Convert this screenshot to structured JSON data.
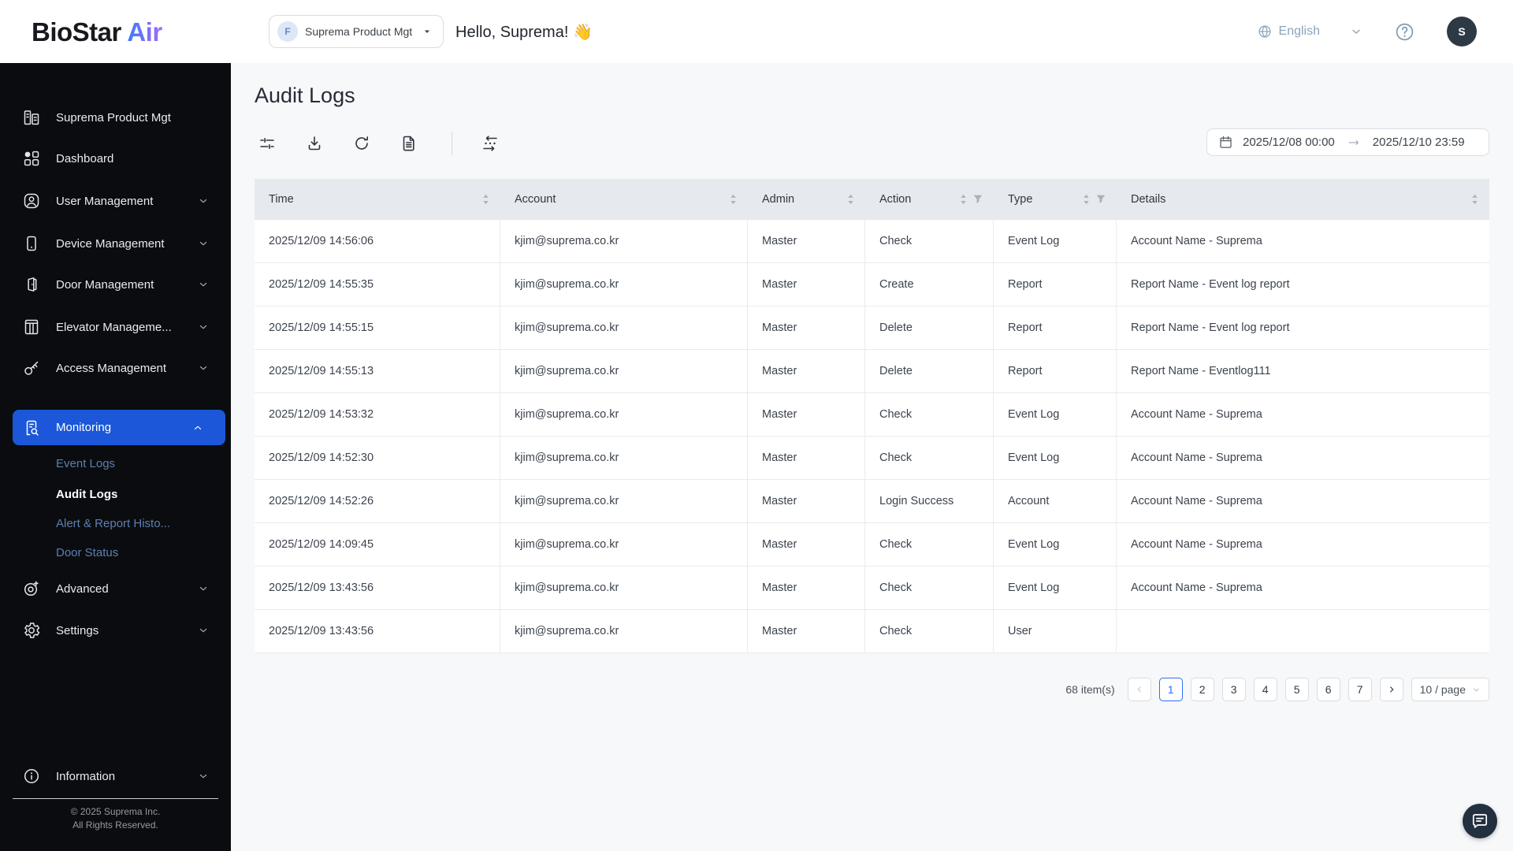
{
  "colors": {
    "sidebar_bg": "#0a0c0f",
    "active_nav_bg": "#1b57d8",
    "subnav_link": "#5e7fb2",
    "pagination_active": "#2f6bff",
    "brand_gradient_start": "#3f7af8",
    "brand_gradient_end": "#a06bfa",
    "topbar_muted": "#8ba4ba"
  },
  "topbar": {
    "brand_primary": "BioStar",
    "brand_accent": "Air",
    "org_badge": "F",
    "org_selector_label": "Suprema Product Mgt",
    "greeting": "Hello, Suprema! 👋",
    "language_label": "English",
    "avatar_initial": "S"
  },
  "sidebar": {
    "items": [
      {
        "label": "Suprema Product Mgt",
        "icon": "building-icon",
        "chevron": false
      },
      {
        "label": "Dashboard",
        "icon": "dashboard-icon",
        "chevron": false
      },
      {
        "label": "User Management",
        "icon": "user-icon",
        "chevron": true
      },
      {
        "label": "Device Management",
        "icon": "device-icon",
        "chevron": true
      },
      {
        "label": "Door Management",
        "icon": "door-icon",
        "chevron": true
      },
      {
        "label": "Elevator Manageme...",
        "icon": "elevator-icon",
        "chevron": true
      },
      {
        "label": "Access Management",
        "icon": "key-icon",
        "chevron": true
      },
      {
        "label": "Monitoring",
        "icon": "monitoring-icon",
        "chevron": true,
        "active": true,
        "expanded": true
      },
      {
        "label": "Advanced",
        "icon": "advanced-icon",
        "chevron": true
      },
      {
        "label": "Settings",
        "icon": "gear-icon",
        "chevron": true
      },
      {
        "label": "Information",
        "icon": "info-icon",
        "chevron": true
      }
    ],
    "monitoring_sub_items": [
      {
        "label": "Event Logs",
        "active": false
      },
      {
        "label": "Audit Logs",
        "active": true
      },
      {
        "label": "Alert & Report Histo...",
        "active": false
      },
      {
        "label": "Door Status",
        "active": false
      }
    ],
    "footer_line1": "© 2025 Suprema Inc.",
    "footer_line2": "All Rights Reserved."
  },
  "page": {
    "title": "Audit Logs"
  },
  "toolbar": {
    "icons": [
      "filter-icon",
      "download-icon",
      "refresh-icon",
      "report-icon",
      "column-order-icon"
    ]
  },
  "date_range": {
    "start": "2025/12/08 00:00",
    "end": "2025/12/10 23:59"
  },
  "table": {
    "columns": [
      {
        "label": "Time",
        "sortable": true,
        "filterable": false
      },
      {
        "label": "Account",
        "sortable": true,
        "filterable": false
      },
      {
        "label": "Admin",
        "sortable": true,
        "filterable": false
      },
      {
        "label": "Action",
        "sortable": true,
        "filterable": true
      },
      {
        "label": "Type",
        "sortable": true,
        "filterable": true
      },
      {
        "label": "Details",
        "sortable": true,
        "filterable": false
      }
    ],
    "rows": [
      [
        "2025/12/09 14:56:06",
        "kjim@suprema.co.kr",
        "Master",
        "Check",
        "Event Log",
        "Account Name - Suprema"
      ],
      [
        "2025/12/09 14:55:35",
        "kjim@suprema.co.kr",
        "Master",
        "Create",
        "Report",
        "Report Name - Event log report"
      ],
      [
        "2025/12/09 14:55:15",
        "kjim@suprema.co.kr",
        "Master",
        "Delete",
        "Report",
        "Report Name - Event log report"
      ],
      [
        "2025/12/09 14:55:13",
        "kjim@suprema.co.kr",
        "Master",
        "Delete",
        "Report",
        "Report Name - Eventlog111"
      ],
      [
        "2025/12/09 14:53:32",
        "kjim@suprema.co.kr",
        "Master",
        "Check",
        "Event Log",
        "Account Name - Suprema"
      ],
      [
        "2025/12/09 14:52:30",
        "kjim@suprema.co.kr",
        "Master",
        "Check",
        "Event Log",
        "Account Name - Suprema"
      ],
      [
        "2025/12/09 14:52:26",
        "kjim@suprema.co.kr",
        "Master",
        "Login Success",
        "Account",
        "Account Name - Suprema"
      ],
      [
        "2025/12/09 14:09:45",
        "kjim@suprema.co.kr",
        "Master",
        "Check",
        "Event Log",
        "Account Name - Suprema"
      ],
      [
        "2025/12/09 13:43:56",
        "kjim@suprema.co.kr",
        "Master",
        "Check",
        "Event Log",
        "Account Name - Suprema"
      ],
      [
        "2025/12/09 13:43:56",
        "kjim@suprema.co.kr",
        "Master",
        "Check",
        "User",
        ""
      ]
    ]
  },
  "pagination": {
    "total_label": "68 item(s)",
    "pages": [
      "1",
      "2",
      "3",
      "4",
      "5",
      "6",
      "7"
    ],
    "current": "1",
    "page_size": "10 / page"
  }
}
